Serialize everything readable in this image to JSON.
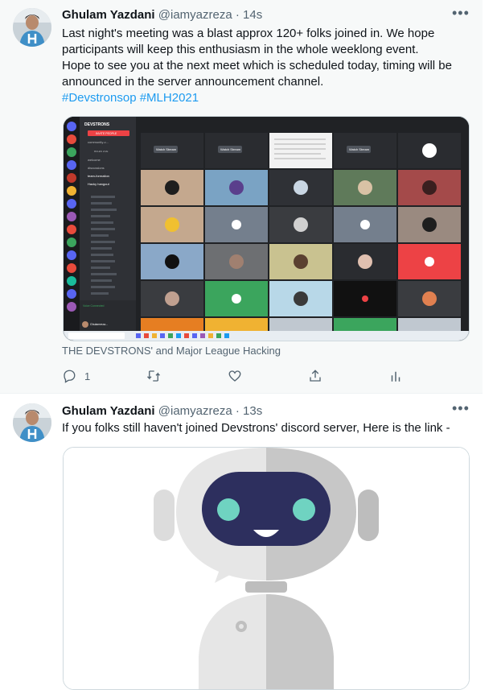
{
  "tweets": [
    {
      "author_name": "Ghulam Yazdani",
      "handle": "@iamyazreza",
      "separator": "·",
      "time": "14s",
      "more_label": "•••",
      "text_line1": "Last night's meeting was a blast approx 120+ folks joined in. We hope",
      "text_line2": "participants will keep this enthusiasm in the whole weeklong event.",
      "text_line3": "Hope to see you at the next meet which is scheduled today, timing will be",
      "text_line4": "announced in the server announcement channel.",
      "hashtags": "#Devstronsop #MLH2021",
      "tagged": "THE DEVSTRONS' and Major League Hacking",
      "reply_count": "1",
      "media": {
        "server_name": "DEVSTRONS",
        "invite_button": "INVITE PEOPLE",
        "channels": [
          "community-c...",
          "RULES LIVE",
          "welcome",
          "discussions",
          "team-formation",
          "Hacky hangout"
        ],
        "tile_label": "Watch Stream",
        "status_line": "Voice Connected",
        "user_label": "Ghulamreza..."
      }
    },
    {
      "author_name": "Ghulam Yazdani",
      "handle": "@iamyazreza",
      "separator": "·",
      "time": "13s",
      "more_label": "•••",
      "text": "If you folks still haven't joined Devstrons' discord server, Here is the link -"
    }
  ],
  "colors": {
    "link": "#1d9bf0",
    "muted": "#536471",
    "discord_dark": "#202225",
    "discord_blurple": "#5865f2",
    "robot_face": "#2d2f5e",
    "robot_eye": "#6fd3c1"
  },
  "icons": [
    "reply-icon",
    "retweet-icon",
    "like-icon",
    "share-icon",
    "analytics-icon",
    "more-icon"
  ]
}
